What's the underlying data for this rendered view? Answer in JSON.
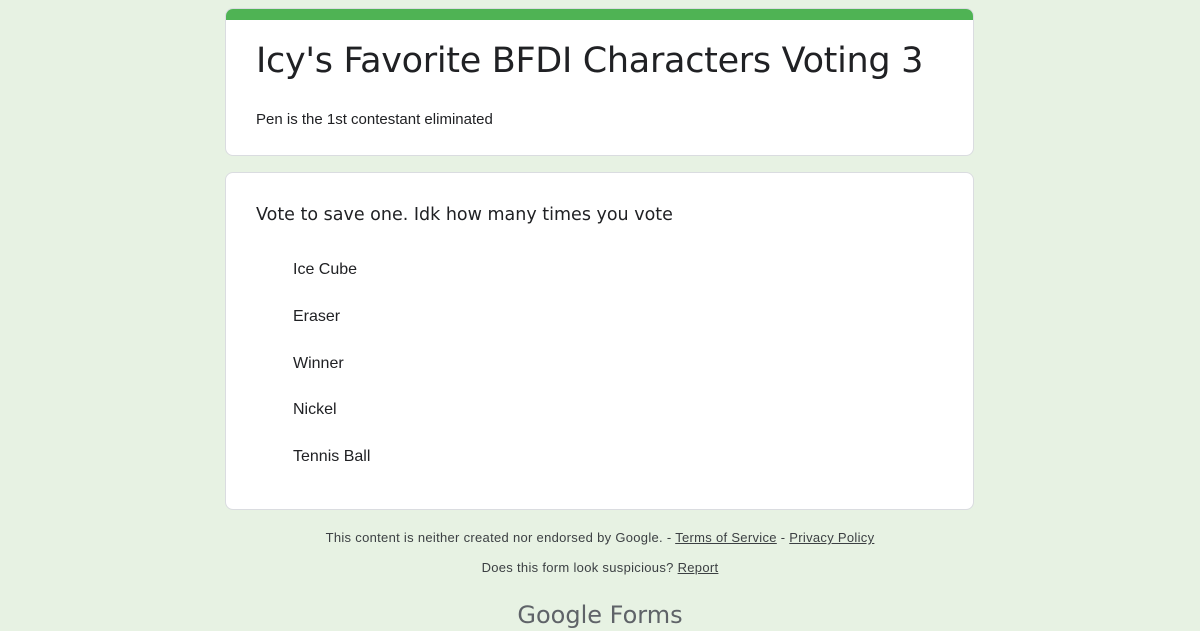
{
  "form": {
    "title": "Icy's Favorite BFDI Characters Voting 3",
    "description": "Pen is the 1st contestant eliminated",
    "accent_color": "#4fb354",
    "background_color": "#e7f2e3"
  },
  "question": {
    "title": "Vote to save one. Idk how many times you vote",
    "options": [
      {
        "label": "Ice Cube"
      },
      {
        "label": "Eraser"
      },
      {
        "label": "Winner"
      },
      {
        "label": "Nickel"
      },
      {
        "label": "Tennis Ball"
      }
    ]
  },
  "footer": {
    "disclaimer": "This content is neither created nor endorsed by Google. -",
    "separator": "-",
    "terms_label": "Terms of Service",
    "privacy_label": "Privacy Policy",
    "suspicious_text": "Does this form look suspicious?",
    "report_label": "Report"
  },
  "branding": {
    "google": "Google",
    "forms": "Forms"
  }
}
